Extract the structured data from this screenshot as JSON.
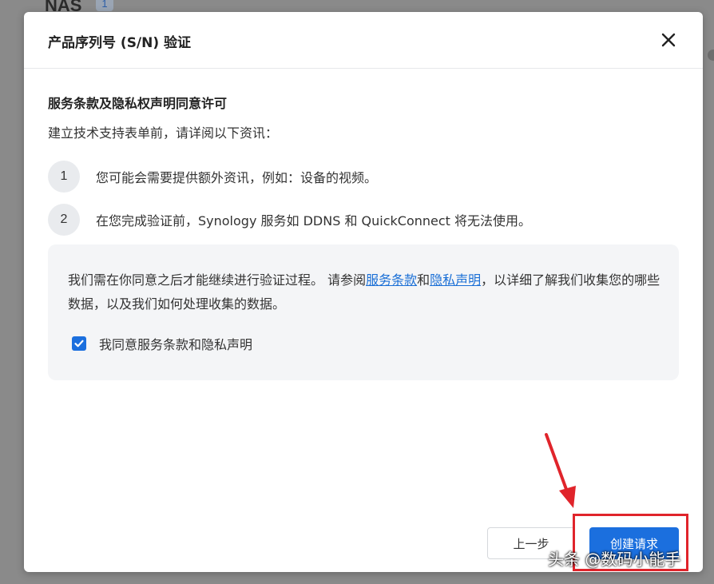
{
  "background": {
    "title": "NAS",
    "badge": "1"
  },
  "dialog": {
    "title": "产品序列号 (S/N) 验证",
    "section_title": "服务条款及隐私权声明同意许可",
    "intro": "建立技术支持表单前，请详阅以下资讯：",
    "steps": [
      {
        "number": "1",
        "text": "您可能会需要提供额外资讯，例如：设备的视频。"
      },
      {
        "number": "2",
        "text": "在您完成验证前，Synology 服务如 DDNS 和 QuickConnect 将无法使用。"
      }
    ],
    "consent": {
      "text_before": "我们需在你同意之后才能继续进行验证过程。 请参阅",
      "terms_link": "服务条款",
      "and": "和",
      "privacy_link": "隐私声明",
      "text_after": "，以详细了解我们收集您的哪些数据，以及我们如何处理收集的数据。",
      "checkbox_label": "我同意服务条款和隐私声明",
      "checked": true
    },
    "buttons": {
      "prev": "上一步",
      "create": "创建请求"
    }
  },
  "watermark": "头条 @数码小能手",
  "colors": {
    "primary": "#1b6fde",
    "annotation": "#e0242b",
    "link": "#1a6fd6"
  }
}
